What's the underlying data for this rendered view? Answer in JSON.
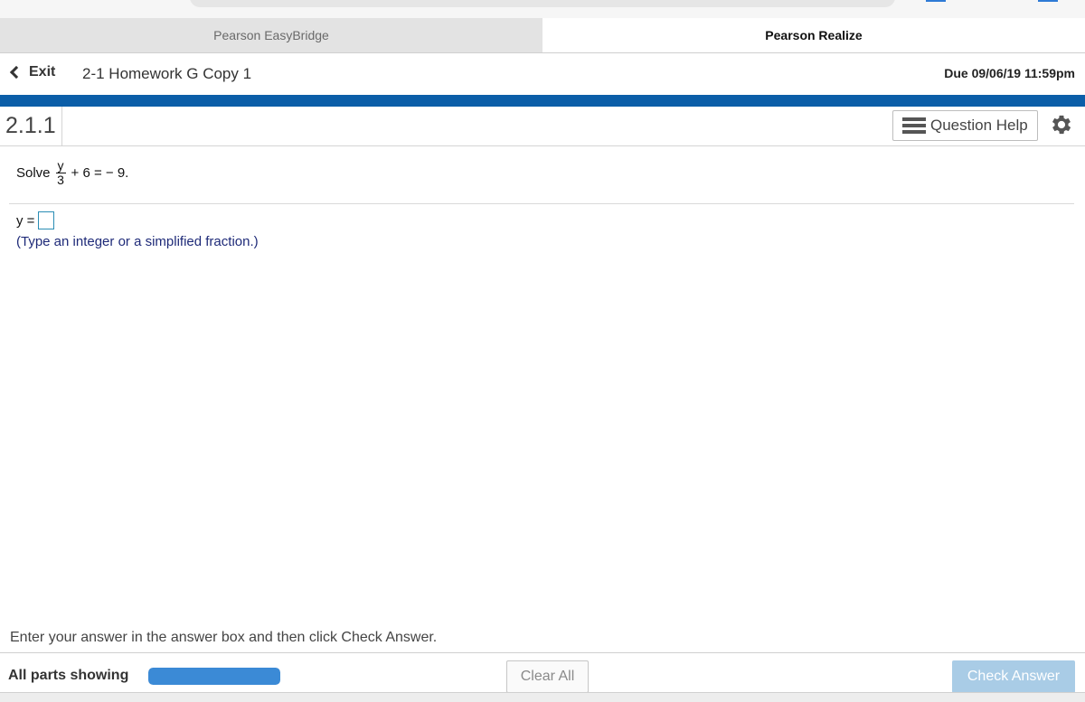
{
  "tabs": {
    "inactive_label": "Pearson EasyBridge",
    "active_label": "Pearson Realize",
    "close_glyph": "×"
  },
  "header": {
    "exit_label": "Exit",
    "assignment_title": "2-1 Homework G Copy 1",
    "due": "Due 09/06/19 11:59pm",
    "accent_bar_color": "#0b5ea8"
  },
  "question": {
    "number": "2.1.1",
    "help_label": "Question Help",
    "help_icon": "list-icon",
    "settings_icon": "gear-icon",
    "prompt_prefix": "Solve",
    "fraction_numerator": "y",
    "fraction_denominator": "3",
    "prompt_suffix": "+ 6 = − 9.",
    "answer_label": "y =",
    "answer_value": "",
    "hint": "(Type an integer or a simplified fraction.)"
  },
  "footer": {
    "instructions": "Enter your answer in the answer box and then click Check Answer.",
    "parts_label": "All parts showing",
    "parts_progress": 1.0,
    "clear_label": "Clear All",
    "check_label": "Check Answer",
    "check_color": "#a9cce6",
    "progress_color": "#3b8ad6"
  }
}
